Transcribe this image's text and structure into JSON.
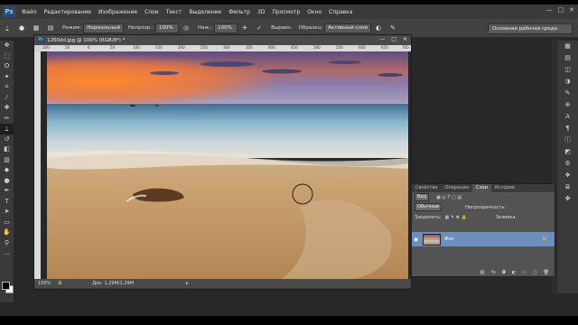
{
  "app": {
    "logo": "Ps"
  },
  "menu": [
    "Файл",
    "Редактирование",
    "Изображение",
    "Слои",
    "Текст",
    "Выделение",
    "Фильтр",
    "3D",
    "Просмотр",
    "Окно",
    "Справка"
  ],
  "window_controls": [
    "—",
    "□",
    "✕"
  ],
  "options": {
    "mode_label": "Режим:",
    "mode_value": "Нормальный",
    "opacity_label": "Непрозр.:",
    "opacity_value": "100%",
    "pressure_label": "Наж.:",
    "pressure_value": "100%",
    "align_label": "Выравн.",
    "sample_label": "Образец:",
    "sample_value": "Активный слой",
    "workspace": "Основная рабочая среда"
  },
  "document": {
    "title": "1260dd.jpg @ 100% (RGB/8*) *",
    "controls": [
      "—",
      "□",
      "✕"
    ],
    "ruler_ticks": [
      "100",
      "50",
      "0",
      "50",
      "100",
      "150",
      "200",
      "250",
      "300",
      "350",
      "400",
      "450",
      "500",
      "550",
      "600",
      "650",
      "700"
    ],
    "zoom": "100%",
    "doc_size": "Док: 1,29M/1,29M"
  },
  "layers_panel": {
    "tabs": [
      "Свойства",
      "Операции",
      "Слои",
      "История"
    ],
    "active_tab": "Слои",
    "filter_label": "Вид",
    "blend_mode": "Обычные",
    "opacity_label": "Непрозрачность:",
    "lock_label": "Закрепить:",
    "fill_label": "Заливка:",
    "layer_name": "Фон"
  },
  "colors": {
    "accent": "#6d8fbf",
    "menubar": "#3a3a3a",
    "panel": "#535353"
  }
}
